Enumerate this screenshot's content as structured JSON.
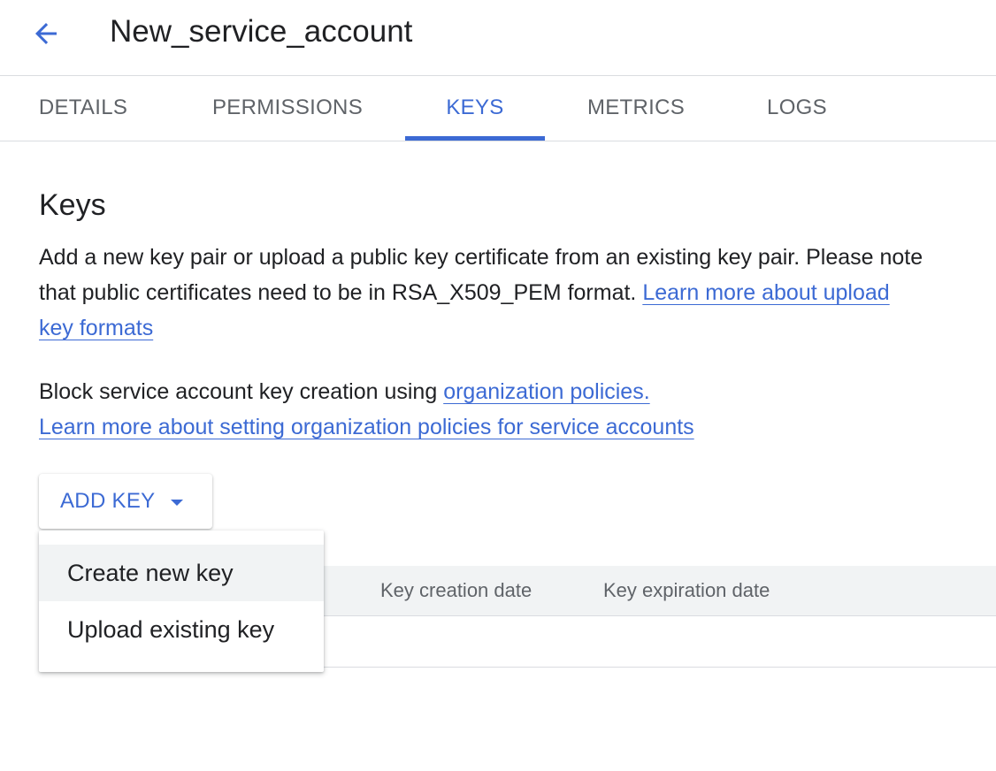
{
  "header": {
    "back_icon": "arrow-back-icon",
    "title": "New_service_account"
  },
  "tabs": [
    {
      "label": "DETAILS",
      "active": false
    },
    {
      "label": "PERMISSIONS",
      "active": false
    },
    {
      "label": "KEYS",
      "active": true
    },
    {
      "label": "METRICS",
      "active": false
    },
    {
      "label": "LOGS",
      "active": false
    }
  ],
  "keys_section": {
    "title": "Keys",
    "description": "Add a new key pair or upload a public key certificate from an existing key pair. Please note that public certificates need to be in RSA_X509_PEM format.",
    "learn_more_formats_link": "Learn more about upload key formats",
    "block_text": "Block service account key creation using",
    "org_policies_link": "organization policies.",
    "learn_more_policies_link": "Learn more about setting organization policies for service accounts"
  },
  "add_key_button": {
    "label": "ADD KEY",
    "icon": "caret-down-icon"
  },
  "add_key_menu": {
    "items": [
      {
        "label": "Create new key",
        "highlighted": true
      },
      {
        "label": "Upload existing key",
        "highlighted": false
      }
    ]
  },
  "keys_table": {
    "columns": [
      "Key creation date",
      "Key expiration date"
    ],
    "rows": []
  },
  "colors": {
    "accent": "#3c6ad4",
    "text": "#202124",
    "muted": "#5f6368",
    "divider": "#dadce0",
    "table_header_bg": "#f1f3f4"
  }
}
